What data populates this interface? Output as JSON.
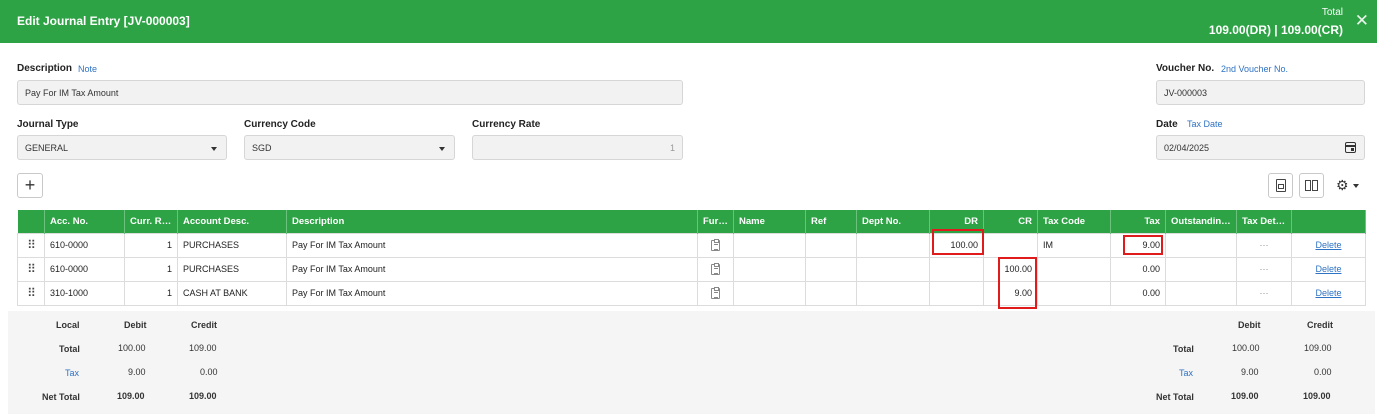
{
  "header": {
    "title": "Edit Journal Entry [JV-000003]",
    "total_label": "Total",
    "total_value": "109.00(DR) | 109.00(CR)",
    "close_glyph": "✕"
  },
  "form": {
    "description_label": "Description",
    "note_link": "Note",
    "description_value": "Pay For IM Tax Amount",
    "voucher_label": "Voucher No.",
    "voucher2_link": "2nd Voucher No.",
    "voucher_value": "JV-000003",
    "journal_type_label": "Journal Type",
    "journal_type_value": "GENERAL",
    "currency_code_label": "Currency Code",
    "currency_code_value": "SGD",
    "currency_rate_label": "Currency Rate",
    "currency_rate_value": "1",
    "date_label": "Date",
    "tax_date_link": "Tax Date",
    "date_value": "02/04/2025"
  },
  "toolbar": {
    "add_glyph": "+",
    "gear_glyph": "⚙"
  },
  "grid": {
    "columns": [
      "",
      "Acc. No.",
      "Curr. Rate",
      "Account Desc.",
      "Description",
      "Furt...",
      "Name",
      "Ref",
      "Dept No.",
      "DR",
      "CR",
      "Tax Code",
      "Tax",
      "Outstanding ...",
      "Tax Detail",
      ""
    ],
    "rows": [
      {
        "drag": "⠿",
        "acc_no": "610-0000",
        "rate": "1",
        "account_desc": "PURCHASES",
        "description": "Pay For IM Tax Amount",
        "name": "",
        "ref": "",
        "dept": "",
        "dr": "100.00",
        "cr": "",
        "tax_code": "IM",
        "tax": "9.00",
        "outstanding": "",
        "tax_detail": "···",
        "action": "Delete"
      },
      {
        "drag": "⠿",
        "acc_no": "610-0000",
        "rate": "1",
        "account_desc": "PURCHASES",
        "description": "Pay For IM Tax Amount",
        "name": "",
        "ref": "",
        "dept": "",
        "dr": "",
        "cr": "100.00",
        "tax_code": "",
        "tax": "0.00",
        "outstanding": "",
        "tax_detail": "···",
        "action": "Delete"
      },
      {
        "drag": "⠿",
        "acc_no": "310-1000",
        "rate": "1",
        "account_desc": "CASH AT BANK",
        "description": "Pay For IM Tax Amount",
        "name": "",
        "ref": "",
        "dept": "",
        "dr": "",
        "cr": "9.00",
        "tax_code": "",
        "tax": "0.00",
        "outstanding": "",
        "tax_detail": "···",
        "action": "Delete"
      }
    ]
  },
  "summary": {
    "left": {
      "local_label": "Local",
      "debit_label": "Debit",
      "credit_label": "Credit",
      "total_label": "Total",
      "total_debit": "100.00",
      "total_credit": "109.00",
      "tax_label": "Tax",
      "tax_debit": "9.00",
      "tax_credit": "0.00",
      "net_label": "Net Total",
      "net_debit": "109.00",
      "net_credit": "109.00"
    },
    "right": {
      "debit_label": "Debit",
      "credit_label": "Credit",
      "total_label": "Total",
      "total_debit": "100.00",
      "total_credit": "109.00",
      "tax_label": "Tax",
      "tax_debit": "9.00",
      "tax_credit": "0.00",
      "net_label": "Net Total",
      "net_debit": "109.00",
      "net_credit": "109.00"
    }
  },
  "colors": {
    "brand_green": "#2ea345",
    "link_blue": "#2f73c4",
    "highlight_red": "#e01b1b"
  }
}
